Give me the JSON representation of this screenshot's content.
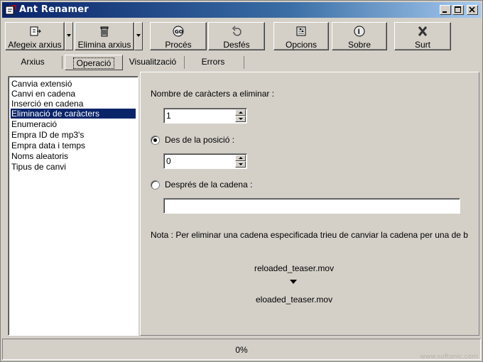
{
  "window": {
    "title": "Ant Renamer",
    "icon": "app-icon"
  },
  "toolbar": {
    "buttons": [
      {
        "label": "Afegeix arxius",
        "icon": "add-file-icon"
      },
      {
        "label": "Elimina arxius",
        "icon": "trash-icon"
      },
      {
        "label": "Procés",
        "icon": "go-icon"
      },
      {
        "label": "Desfés",
        "icon": "undo-icon"
      },
      {
        "label": "Opcions",
        "icon": "options-icon"
      },
      {
        "label": "Sobre",
        "icon": "about-icon"
      },
      {
        "label": "Surt",
        "icon": "exit-icon"
      }
    ]
  },
  "tabs": [
    {
      "label": "Arxius"
    },
    {
      "label": "Operació"
    },
    {
      "label": "Visualització"
    },
    {
      "label": "Errors"
    }
  ],
  "operations": {
    "items": [
      "Canvia extensió",
      "Canvi en cadena",
      "Inserció en cadena",
      "Eliminació de caràcters",
      "Enumeració",
      "Empra ID de mp3's",
      "Empra data i temps",
      "Noms aleatoris",
      "Tipus de canvi"
    ],
    "selected": "Eliminació de caràcters"
  },
  "form": {
    "count_label": "Nombre de caràcters a eliminar :",
    "count_value": "1",
    "from_position_label": "Des de la posició :",
    "position_value": "0",
    "after_string_label": "Després de la cadena :",
    "after_string_value": "",
    "note": "Nota : Per eliminar una cadena especificada trieu de canviar la cadena per una de b",
    "preview_before": "reloaded_teaser.mov",
    "preview_after": "eloaded_teaser.mov"
  },
  "status": {
    "progress_text": "0%"
  },
  "watermark": "www.softonic.com"
}
